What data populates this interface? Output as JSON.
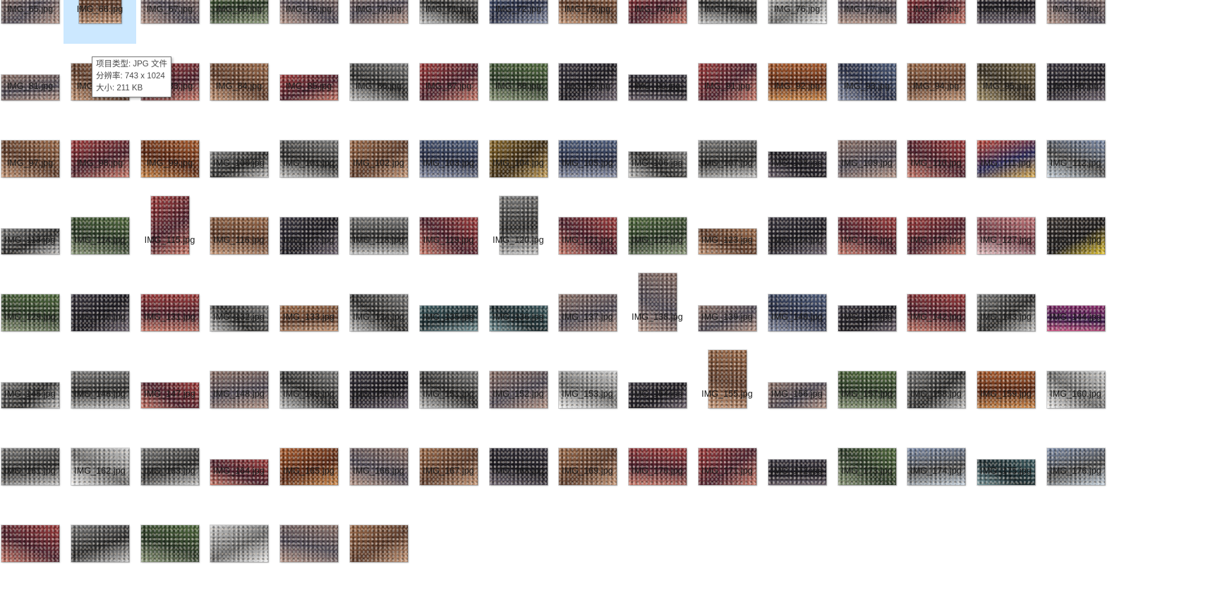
{
  "tooltip": {
    "type_line": "项目类型: JPG 文件",
    "resolution_line": "分辨率: 743 x 1024",
    "size_line": "大小: 211 KB"
  },
  "files": [
    {
      "name": "IMG_65.jpg",
      "aspect": "landscape",
      "tone": "color"
    },
    {
      "name": "IMG_66.jpg",
      "aspect": "square",
      "tone": "warm"
    },
    {
      "name": "IMG_67.jpg",
      "aspect": "landscape",
      "tone": "color"
    },
    {
      "name": "IMG_68.jpg",
      "aspect": "landscape",
      "tone": "green"
    },
    {
      "name": "IMG_69.jpg",
      "aspect": "landscape",
      "tone": "color"
    },
    {
      "name": "IMG_70.jpg",
      "aspect": "landscape",
      "tone": "color"
    },
    {
      "name": "IMG_71.jpg",
      "aspect": "landscape",
      "tone": "gray"
    },
    {
      "name": "IMG_72.jpg",
      "aspect": "landscape",
      "tone": "blue"
    },
    {
      "name": "IMG_73.jpg",
      "aspect": "landscape",
      "tone": "warm"
    },
    {
      "name": "IMG_74.jpg",
      "aspect": "landscape",
      "tone": "red"
    },
    {
      "name": "IMG_75.jpg",
      "aspect": "landscape",
      "tone": "gray"
    },
    {
      "name": "IMG_76.jpg",
      "aspect": "landscape",
      "tone": "light"
    },
    {
      "name": "IMG_77.jpg",
      "aspect": "landscape",
      "tone": "color"
    },
    {
      "name": "IMG_78.jpg",
      "aspect": "landscape",
      "tone": "red"
    },
    {
      "name": "IMG_79.jpg",
      "aspect": "landscape",
      "tone": "dark"
    },
    {
      "name": "IMG_80.jpg",
      "aspect": "landscape",
      "tone": "color"
    },
    {
      "name": "IMG_81.jpg",
      "aspect": "wide",
      "tone": "color"
    },
    {
      "name": "IMG_82.jpg",
      "aspect": "landscape",
      "tone": "warm"
    },
    {
      "name": "IMG_83.jpg",
      "aspect": "landscape",
      "tone": "red"
    },
    {
      "name": "IMG_84.jpg",
      "aspect": "landscape",
      "tone": "warm"
    },
    {
      "name": "IMG_85.jpg",
      "aspect": "wide",
      "tone": "red"
    },
    {
      "name": "IMG_86.jpg",
      "aspect": "landscape",
      "tone": "gray"
    },
    {
      "name": "IMG_87.jpg",
      "aspect": "landscape",
      "tone": "red"
    },
    {
      "name": "IMG_88.jpg",
      "aspect": "landscape",
      "tone": "green"
    },
    {
      "name": "IMG_89.jpg",
      "aspect": "landscape",
      "tone": "dark"
    },
    {
      "name": "IMG_90.jpg",
      "aspect": "wide",
      "tone": "dark"
    },
    {
      "name": "IMG_91.jpg",
      "aspect": "landscape",
      "tone": "red"
    },
    {
      "name": "IMG_92.jpg",
      "aspect": "landscape",
      "tone": "orange"
    },
    {
      "name": "IMG_93.jpg",
      "aspect": "landscape",
      "tone": "blue"
    },
    {
      "name": "IMG_94.jpg",
      "aspect": "landscape",
      "tone": "warm"
    },
    {
      "name": "IMG_95.jpg",
      "aspect": "landscape",
      "tone": "olive"
    },
    {
      "name": "IMG_96.jpg",
      "aspect": "landscape",
      "tone": "dark"
    },
    {
      "name": "IMG_97.jpg",
      "aspect": "landscape",
      "tone": "warm"
    },
    {
      "name": "IMG_98.jpg",
      "aspect": "landscape",
      "tone": "red"
    },
    {
      "name": "IMG_99.jpg",
      "aspect": "landscape",
      "tone": "orange"
    },
    {
      "name": "IMG_100.jpg",
      "aspect": "wide",
      "tone": "gray"
    },
    {
      "name": "IMG_101.jpg",
      "aspect": "landscape",
      "tone": "gray"
    },
    {
      "name": "IMG_102.jpg",
      "aspect": "landscape",
      "tone": "warm"
    },
    {
      "name": "IMG_103.jpg",
      "aspect": "landscape",
      "tone": "blue"
    },
    {
      "name": "IMG_104.jpg",
      "aspect": "landscape",
      "tone": "gold"
    },
    {
      "name": "IMG_105.jpg",
      "aspect": "landscape",
      "tone": "blue"
    },
    {
      "name": "IMG_106.jpg",
      "aspect": "wide",
      "tone": "gray"
    },
    {
      "name": "IMG_107.jpg",
      "aspect": "landscape",
      "tone": "gray"
    },
    {
      "name": "IMG_108.jpg",
      "aspect": "wide",
      "tone": "dark"
    },
    {
      "name": "IMG_109.jpg",
      "aspect": "landscape",
      "tone": "color"
    },
    {
      "name": "IMG_110.jpg",
      "aspect": "landscape",
      "tone": "red"
    },
    {
      "name": "IMG_111.jpg",
      "aspect": "landscape",
      "tone": "stage"
    },
    {
      "name": "IMG_112.jpg",
      "aspect": "landscape",
      "tone": "sky"
    },
    {
      "name": "IMG_113.jpg",
      "aspect": "wide",
      "tone": "gray"
    },
    {
      "name": "IMG_114.jpg",
      "aspect": "landscape",
      "tone": "green"
    },
    {
      "name": "IMG_115.jpg",
      "aspect": "portrait",
      "tone": "red"
    },
    {
      "name": "IMG_116.jpg",
      "aspect": "landscape",
      "tone": "warm"
    },
    {
      "name": "IMG_117.jpg",
      "aspect": "landscape",
      "tone": "dark"
    },
    {
      "name": "IMG_118.jpg",
      "aspect": "landscape",
      "tone": "gray"
    },
    {
      "name": "IMG_119.jpg",
      "aspect": "landscape",
      "tone": "red"
    },
    {
      "name": "IMG_120.jpg",
      "aspect": "portrait",
      "tone": "gray"
    },
    {
      "name": "IMG_121.jpg",
      "aspect": "landscape",
      "tone": "red"
    },
    {
      "name": "IMG_122.jpg",
      "aspect": "landscape",
      "tone": "green"
    },
    {
      "name": "IMG_123.jpg",
      "aspect": "wide",
      "tone": "warm"
    },
    {
      "name": "IMG_124.jpg",
      "aspect": "landscape",
      "tone": "dark"
    },
    {
      "name": "IMG_125.jpg",
      "aspect": "landscape",
      "tone": "red"
    },
    {
      "name": "IMG_126.jpg",
      "aspect": "landscape",
      "tone": "red"
    },
    {
      "name": "IMG_127.jpg",
      "aspect": "landscape",
      "tone": "pink"
    },
    {
      "name": "IMG_128.jpg",
      "aspect": "landscape",
      "tone": "yellow"
    },
    {
      "name": "IMG_129.jpg",
      "aspect": "landscape",
      "tone": "green"
    },
    {
      "name": "IMG_130.jpg",
      "aspect": "landscape",
      "tone": "dark"
    },
    {
      "name": "IMG_131.jpg",
      "aspect": "landscape",
      "tone": "red"
    },
    {
      "name": "IMG_132.jpg",
      "aspect": "wide",
      "tone": "gray"
    },
    {
      "name": "IMG_133.jpg",
      "aspect": "wide",
      "tone": "warm"
    },
    {
      "name": "IMG_134.jpg",
      "aspect": "landscape",
      "tone": "gray"
    },
    {
      "name": "IMG_135.jpg",
      "aspect": "wide",
      "tone": "teal"
    },
    {
      "name": "IMG_136.jpg",
      "aspect": "wide",
      "tone": "teal"
    },
    {
      "name": "IMG_137.jpg",
      "aspect": "landscape",
      "tone": "color"
    },
    {
      "name": "IMG_138.jpg",
      "aspect": "portrait",
      "tone": "color"
    },
    {
      "name": "IMG_139.jpg",
      "aspect": "wide",
      "tone": "color"
    },
    {
      "name": "IMG_140.jpg",
      "aspect": "landscape",
      "tone": "blue"
    },
    {
      "name": "IMG_141.jpg",
      "aspect": "wide",
      "tone": "dark"
    },
    {
      "name": "IMG_142.jpg",
      "aspect": "landscape",
      "tone": "red"
    },
    {
      "name": "IMG_143.jpg",
      "aspect": "landscape",
      "tone": "gray"
    },
    {
      "name": "IMG_144.jpg",
      "aspect": "wide",
      "tone": "magenta"
    },
    {
      "name": "IMG_145.jpg",
      "aspect": "wide",
      "tone": "gray"
    },
    {
      "name": "IMG_146.jpg",
      "aspect": "landscape",
      "tone": "gray"
    },
    {
      "name": "IMG_147.jpg",
      "aspect": "wide",
      "tone": "red"
    },
    {
      "name": "IMG_148.jpg",
      "aspect": "landscape",
      "tone": "color"
    },
    {
      "name": "IMG_149.jpg",
      "aspect": "landscape",
      "tone": "gray"
    },
    {
      "name": "IMG_150.jpg",
      "aspect": "landscape",
      "tone": "dark"
    },
    {
      "name": "IMG_151.jpg",
      "aspect": "landscape",
      "tone": "gray"
    },
    {
      "name": "IMG_152.jpg",
      "aspect": "landscape",
      "tone": "color"
    },
    {
      "name": "IMG_153.jpg",
      "aspect": "landscape",
      "tone": "light"
    },
    {
      "name": "IMG_154.jpg",
      "aspect": "wide",
      "tone": "dark"
    },
    {
      "name": "IMG_155.jpg",
      "aspect": "portrait",
      "tone": "warm"
    },
    {
      "name": "IMG_156.jpg",
      "aspect": "wide",
      "tone": "color"
    },
    {
      "name": "IMG_157.jpg",
      "aspect": "landscape",
      "tone": "green"
    },
    {
      "name": "IMG_158.jpg",
      "aspect": "landscape",
      "tone": "gray"
    },
    {
      "name": "IMG_159.jpg",
      "aspect": "landscape",
      "tone": "orange"
    },
    {
      "name": "IMG_160.jpg",
      "aspect": "landscape",
      "tone": "light"
    },
    {
      "name": "IMG_161.jpg",
      "aspect": "landscape",
      "tone": "gray"
    },
    {
      "name": "IMG_162.jpg",
      "aspect": "landscape",
      "tone": "light"
    },
    {
      "name": "IMG_163.jpg",
      "aspect": "landscape",
      "tone": "gray"
    },
    {
      "name": "IMG_164.jpg",
      "aspect": "wide",
      "tone": "red"
    },
    {
      "name": "IMG_165.jpg",
      "aspect": "landscape",
      "tone": "orange"
    },
    {
      "name": "IMG_166.jpg",
      "aspect": "landscape",
      "tone": "color"
    },
    {
      "name": "IMG_167.jpg",
      "aspect": "landscape",
      "tone": "warm"
    },
    {
      "name": "IMG_168.jpg",
      "aspect": "landscape",
      "tone": "dark"
    },
    {
      "name": "IMG_169.jpg",
      "aspect": "landscape",
      "tone": "warm"
    },
    {
      "name": "IMG_170.jpg",
      "aspect": "landscape",
      "tone": "red"
    },
    {
      "name": "IMG_171.jpg",
      "aspect": "landscape",
      "tone": "red"
    },
    {
      "name": "IMG_172.jpg",
      "aspect": "wide",
      "tone": "dark"
    },
    {
      "name": "IMG_173.jpg",
      "aspect": "landscape",
      "tone": "green"
    },
    {
      "name": "IMG_174.jpg",
      "aspect": "landscape",
      "tone": "sky"
    },
    {
      "name": "IMG_175.jpg",
      "aspect": "wide",
      "tone": "teal"
    },
    {
      "name": "IMG_176.jpg",
      "aspect": "landscape",
      "tone": "sky"
    },
    {
      "name": "",
      "aspect": "landscape",
      "tone": "red"
    },
    {
      "name": "",
      "aspect": "landscape",
      "tone": "gray"
    },
    {
      "name": "",
      "aspect": "landscape",
      "tone": "green"
    },
    {
      "name": "",
      "aspect": "landscape",
      "tone": "light"
    },
    {
      "name": "",
      "aspect": "landscape",
      "tone": "color"
    },
    {
      "name": "",
      "aspect": "landscape",
      "tone": "warm"
    }
  ],
  "tones": {
    "color": [
      "#8a6f66",
      "#4f4a55",
      "#b79688"
    ],
    "warm": [
      "#9c6b4a",
      "#5e3d2d",
      "#c99a7a"
    ],
    "red": [
      "#9e3a3a",
      "#4e2430",
      "#cc7a6a"
    ],
    "green": [
      "#4f6a3c",
      "#2d3a2a",
      "#8c9a7a"
    ],
    "gray": [
      "#7a7a7a",
      "#2c2c2c",
      "#c8c8c8"
    ],
    "light": [
      "#cfcfcf",
      "#6a6a6a",
      "#f2f2f2"
    ],
    "dark": [
      "#3a3640",
      "#1e1c22",
      "#6e6470"
    ],
    "blue": [
      "#4c5c7c",
      "#2a2f45",
      "#8a92aa"
    ],
    "orange": [
      "#a85a2c",
      "#5a2a18",
      "#d08a4a"
    ],
    "olive": [
      "#6e6040",
      "#3a3226",
      "#a8956a"
    ],
    "gold": [
      "#8a6a2c",
      "#3c2c16",
      "#c8a25a"
    ],
    "stage": [
      "#c24a3a",
      "#2a2a5a",
      "#e0b050"
    ],
    "sky": [
      "#7a8aa8",
      "#4a4a4a",
      "#c8d4e0"
    ],
    "pink": [
      "#c4767a",
      "#6a3a44",
      "#ecc6c8"
    ],
    "yellow": [
      "#3a3432",
      "#1e1c1c",
      "#e8c830"
    ],
    "teal": [
      "#3a5a60",
      "#1e2c30",
      "#7a9aa0"
    ],
    "magenta": [
      "#8a2a6a",
      "#3a1c4a",
      "#d05a8a"
    ]
  },
  "selected_index": 1
}
